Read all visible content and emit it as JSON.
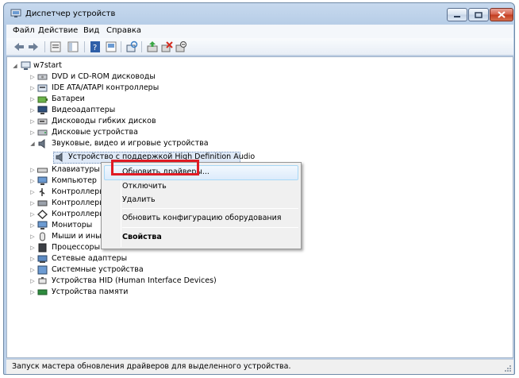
{
  "window": {
    "title": "Диспетчер устройств"
  },
  "menu": [
    "Файл",
    "Действие",
    "Вид",
    "Справка"
  ],
  "toolbar": {
    "icons": [
      "back-arrow-icon",
      "forward-arrow-icon",
      "properties-icon",
      "console-tree-icon",
      "help-icon",
      "show-hidden-icon",
      "scan-hardware-icon",
      "update-driver-icon",
      "uninstall-icon",
      "disable-icon"
    ]
  },
  "tree": {
    "root": "w7start",
    "items": [
      "DVD и CD-ROM дисководы",
      "IDE ATA/ATAPI контроллеры",
      "Батареи",
      "Видеоадаптеры",
      "Дисководы гибких дисков",
      "Дисковые устройства",
      "Звуковые, видео и игровые устройства",
      "Устройство с поддержкой High Definition Audio",
      "Клавиатуры",
      "Компьютер",
      "Контроллеры",
      "Контроллеры",
      "Контроллеры",
      "Мониторы",
      "Мыши и иные",
      "Процессоры",
      "Сетевые адаптеры",
      "Системные устройства",
      "Устройства HID (Human Interface Devices)",
      "Устройства памяти"
    ]
  },
  "context_menu": {
    "update": "Обновить драйверы...",
    "disable": "Отключить",
    "delete": "Удалить",
    "scan": "Обновить конфигурацию оборудования",
    "properties": "Свойства"
  },
  "status": "Запуск мастера обновления драйверов для выделенного устройства.",
  "colors": {
    "highlight_frame": "#e01b24",
    "title_bg": "#b9cfe8"
  }
}
